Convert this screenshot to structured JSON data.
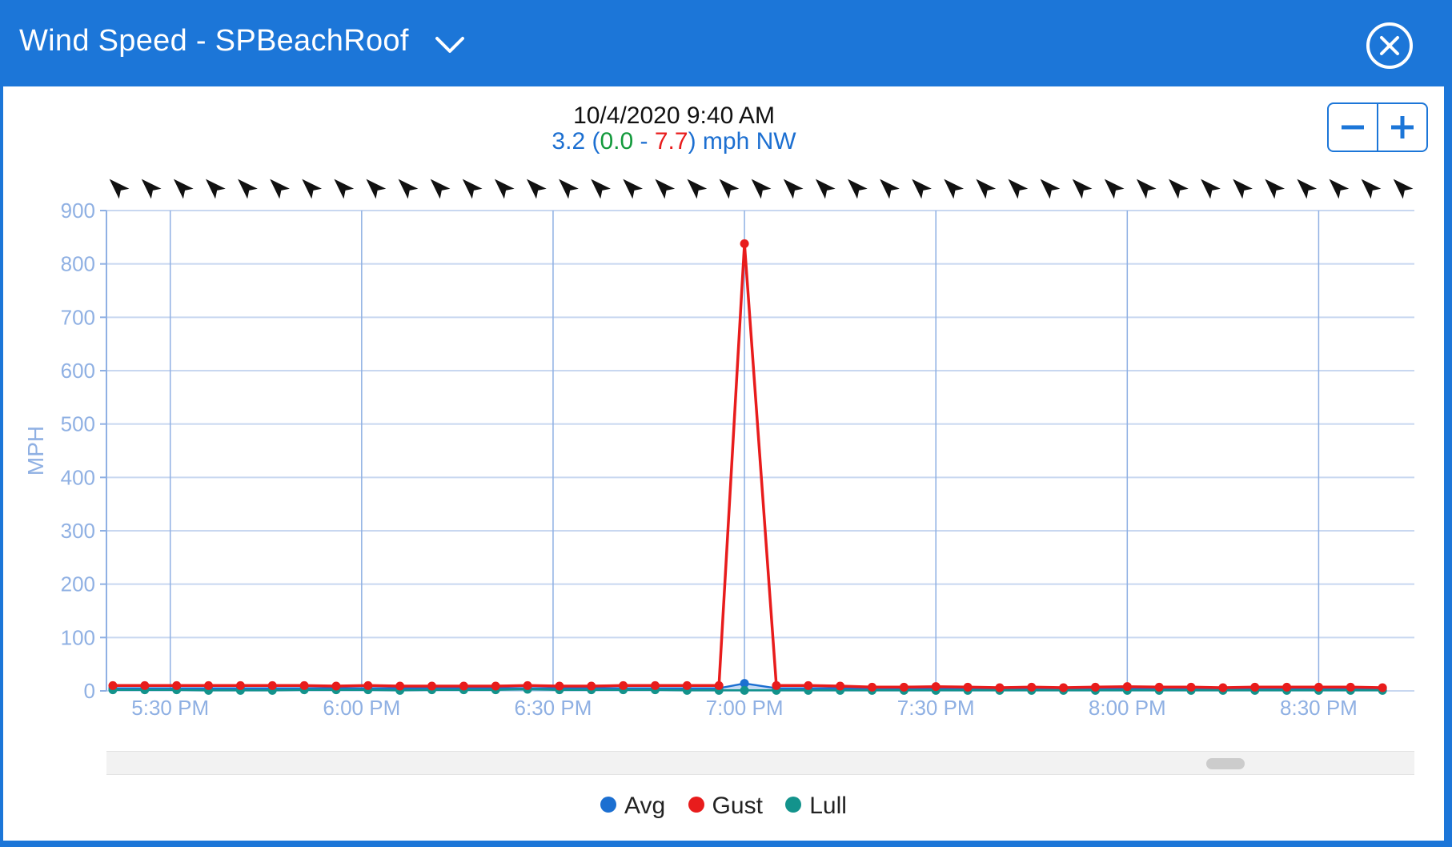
{
  "window": {
    "title": "Wind Speed - SPBeachRoof",
    "title_dropdown_icon": "chevron-down-icon",
    "close_icon": "close-circle-icon",
    "background_color": "#1c76d8"
  },
  "readout": {
    "timestamp": "10/4/2020 9:40 AM",
    "avg": "3.2",
    "open_paren": " (",
    "lull": "0.0",
    "dash": " - ",
    "gust": "7.7",
    "suffix": ") mph NW"
  },
  "zoom": {
    "out_icon": "minus-icon",
    "in_icon": "plus-icon"
  },
  "colors": {
    "avg": "#1c6fd1",
    "gust": "#e81c1c",
    "lull": "#13938c",
    "axis_text": "#8fb0e3",
    "grid": "#c8d7f0",
    "vgrid": "#8fb0e3"
  },
  "chart_data": {
    "type": "line",
    "ylabel": "MPH",
    "ylim": [
      0,
      900
    ],
    "yticks": [
      0,
      100,
      200,
      300,
      400,
      500,
      600,
      700,
      800,
      900
    ],
    "xlim": [
      "5:20 PM",
      "8:45 PM"
    ],
    "x_tick_labels": [
      "5:30 PM",
      "6:00 PM",
      "6:30 PM",
      "7:00 PM",
      "7:30 PM",
      "8:00 PM",
      "8:30 PM"
    ],
    "x": [
      "5:21 PM",
      "5:26 PM",
      "5:31 PM",
      "5:36 PM",
      "5:41 PM",
      "5:46 PM",
      "5:51 PM",
      "5:56 PM",
      "6:01 PM",
      "6:06 PM",
      "6:11 PM",
      "6:16 PM",
      "6:21 PM",
      "6:26 PM",
      "6:31 PM",
      "6:36 PM",
      "6:41 PM",
      "6:46 PM",
      "6:51 PM",
      "6:56 PM",
      "7:00 PM",
      "7:05 PM",
      "7:10 PM",
      "7:15 PM",
      "7:20 PM",
      "7:25 PM",
      "7:30 PM",
      "7:35 PM",
      "7:40 PM",
      "7:45 PM",
      "7:50 PM",
      "7:55 PM",
      "8:00 PM",
      "8:05 PM",
      "8:10 PM",
      "8:15 PM",
      "8:20 PM",
      "8:25 PM",
      "8:30 PM",
      "8:35 PM",
      "8:40 PM"
    ],
    "grid": true,
    "legend_position": "bottom-center",
    "series": [
      {
        "name": "Avg",
        "color": "#1c6fd1",
        "values": [
          5,
          5,
          5,
          5,
          5,
          5,
          5,
          5,
          5,
          5,
          5,
          5,
          5,
          5,
          5,
          5,
          5,
          5,
          5,
          5,
          14,
          5,
          5,
          5,
          5,
          5,
          5,
          5,
          5,
          5,
          5,
          5,
          5,
          5,
          5,
          5,
          5,
          5,
          5,
          5,
          5
        ]
      },
      {
        "name": "Gust",
        "color": "#e81c1c",
        "values": [
          10,
          10,
          10,
          10,
          10,
          10,
          10,
          9,
          10,
          9,
          9,
          9,
          9,
          10,
          9,
          9,
          10,
          10,
          10,
          10,
          838,
          10,
          10,
          9,
          7,
          7,
          8,
          7,
          6,
          7,
          6,
          7,
          8,
          7,
          7,
          6,
          7,
          7,
          7,
          7,
          6
        ]
      },
      {
        "name": "Lull",
        "color": "#13938c",
        "values": [
          2,
          2,
          2,
          1,
          1,
          1,
          2,
          2,
          2,
          1,
          2,
          2,
          2,
          3,
          2,
          2,
          2,
          2,
          1,
          1,
          1,
          1,
          1,
          1,
          1,
          1,
          1,
          1,
          1,
          1,
          1,
          1,
          1,
          1,
          1,
          1,
          1,
          1,
          1,
          1,
          1
        ]
      }
    ],
    "direction_arrows": {
      "count": 41,
      "direction": "NW"
    }
  },
  "legend": {
    "items": [
      {
        "label": "Avg",
        "color": "#1c6fd1"
      },
      {
        "label": "Gust",
        "color": "#e81c1c"
      },
      {
        "label": "Lull",
        "color": "#13938c"
      }
    ]
  }
}
